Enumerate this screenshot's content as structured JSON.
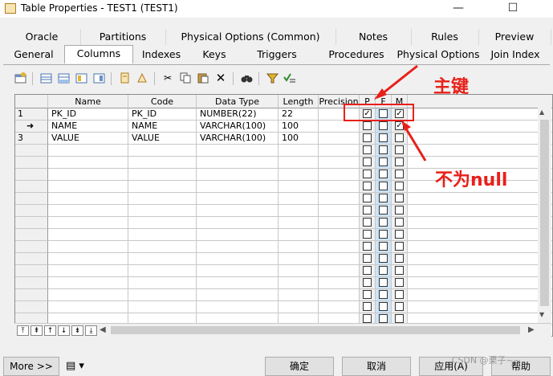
{
  "window": {
    "title": "Table Properties - TEST1 (TEST1)",
    "minimize": "—",
    "maximize": "☐",
    "close": "✕"
  },
  "tabs_row1": [
    "Oracle",
    "Partitions",
    "Physical Options (Common)",
    "Notes",
    "Rules",
    "Preview"
  ],
  "tabs_row2": [
    "General",
    "Columns",
    "Indexes",
    "Keys",
    "Triggers",
    "Procedures",
    "Physical Options",
    "Join Index"
  ],
  "active_tab": "Columns",
  "grid": {
    "headers": [
      "Name",
      "Code",
      "Data Type",
      "Length",
      "Precision",
      "P",
      "F",
      "M"
    ],
    "rows": [
      {
        "marker": "1",
        "name": "PK_ID",
        "code": "PK_ID",
        "type": "NUMBER(22)",
        "length": "22",
        "precision": "",
        "p": true,
        "f": false,
        "m": true
      },
      {
        "marker": "➜",
        "name": "NAME",
        "code": "NAME",
        "type": "VARCHAR(100)",
        "length": "100",
        "precision": "",
        "p": false,
        "f": false,
        "m": true
      },
      {
        "marker": "3",
        "name": "VALUE",
        "code": "VALUE",
        "type": "VARCHAR(100)",
        "length": "100",
        "precision": "",
        "p": false,
        "f": false,
        "m": false
      }
    ]
  },
  "annotations": {
    "primary_key": "主键",
    "not_null": "不为null"
  },
  "buttons": {
    "more": "More >>",
    "ok": "确定",
    "cancel": "取消",
    "apply": "应用(A)",
    "help": "帮助"
  },
  "watermark": "CSDN @栗子~~",
  "colors": {
    "annotation": "#e8201a",
    "foreign_col": "#cde4f7"
  }
}
